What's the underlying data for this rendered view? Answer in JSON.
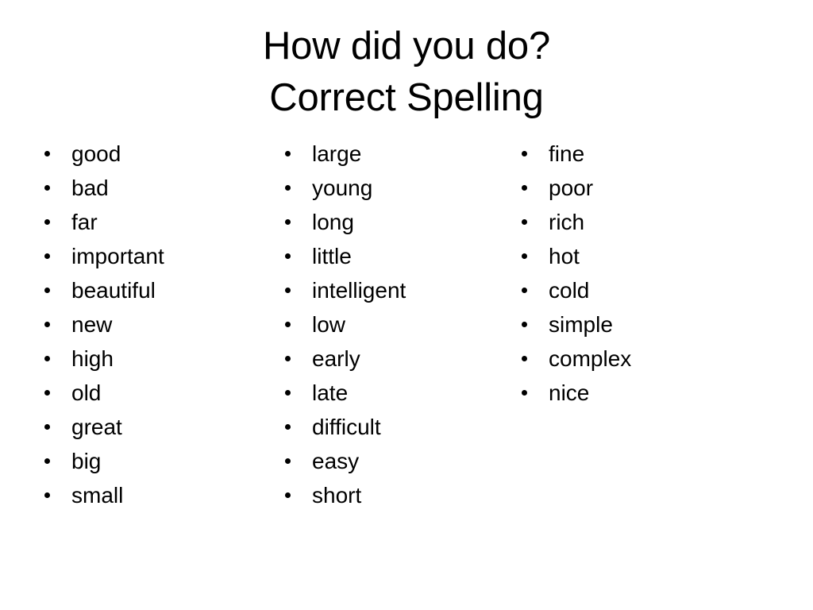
{
  "slide": {
    "background_color": "#ffffff",
    "text_color": "#000000",
    "title": {
      "line1": "How did you do?",
      "line2": "Correct Spelling"
    },
    "columns": [
      {
        "name": "column-1",
        "bullet_icon": "bullet-dot-icon",
        "items": [
          "good",
          "bad",
          "far",
          "important",
          "beautiful",
          "new",
          "high",
          "old",
          "great",
          "big",
          "small"
        ]
      },
      {
        "name": "column-2",
        "bullet_icon": "bullet-dot-icon",
        "items": [
          "large",
          "young",
          "long",
          "little",
          "intelligent",
          "low",
          "early",
          "late",
          "difficult",
          "easy",
          "short"
        ]
      },
      {
        "name": "column-3",
        "bullet_icon": "bullet-dot-icon",
        "items": [
          "fine",
          "poor",
          "rich",
          "hot",
          "cold",
          "simple",
          "complex",
          "nice"
        ]
      }
    ]
  }
}
